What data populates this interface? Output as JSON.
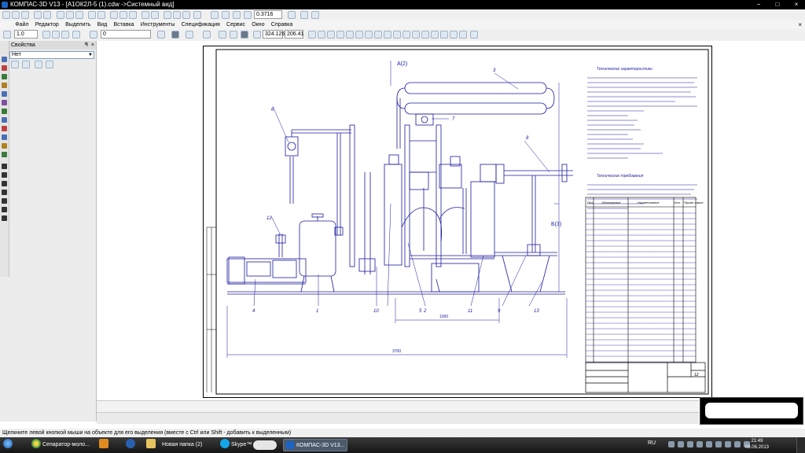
{
  "window": {
    "title": "КОМПАС-3D V13 - [А1ОК2Л-5 (1).cdw ->Системный вид]",
    "controls": [
      "−",
      "□",
      "×"
    ]
  },
  "toolbar": {
    "zoom_value": "0.3716",
    "line_width": "1.0",
    "layer_value": "0",
    "coord_x": "324.126",
    "coord_y": "206.41"
  },
  "menu": {
    "items": [
      "Файл",
      "Редактор",
      "Выделить",
      "Вид",
      "Вставка",
      "Инструменты",
      "Спецификация",
      "Сервис",
      "Окно",
      "Справка"
    ]
  },
  "properties_panel": {
    "title": "Свойства",
    "pin": "ꟼ",
    "close": "×",
    "combo_value": "Нет"
  },
  "drawing": {
    "title_text": "Технические характеристики",
    "req_title": "Технические требования",
    "section_a": "А(2)",
    "section_b": "Б(3)",
    "dim_total": "3700",
    "dim_mid": "1000",
    "callouts": [
      "1",
      "2",
      "3",
      "4",
      "5",
      "6",
      "7",
      "8",
      "9",
      "10",
      "11",
      "12",
      "13"
    ],
    "spec_headers": [
      "Поз.",
      "Обозначение",
      "Наименование",
      "Кол.",
      "Приме-чание"
    ],
    "sheet_number": "12"
  },
  "status": {
    "hint": "Щелкните левой кнопкой мыши на объекте для его выделения (вместе с Ctrl или Shift - добавить к выделенным)"
  },
  "taskbar": {
    "items": [
      {
        "label": "Сепаратор-моло..."
      },
      {
        "label": "Новая папка (2)"
      },
      {
        "label": "Skype™"
      },
      {
        "label": "КОМПАС-3D V13..."
      }
    ],
    "lang": "RU",
    "time": "21:49",
    "date": "08.06.2013"
  },
  "colors": {
    "drawing_ink": "#1a1aa0",
    "titlebar": "#000000"
  }
}
